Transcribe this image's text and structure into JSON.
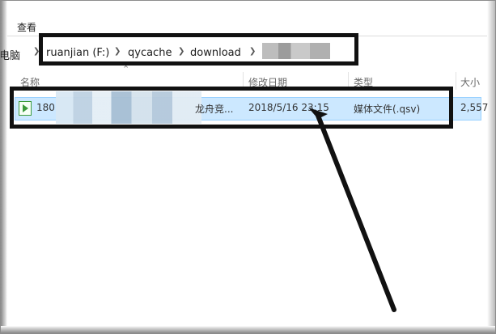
{
  "ribbon": {
    "view_label": "查看"
  },
  "address": {
    "root": "电脑",
    "crumbs": [
      "ruanjian (F:)",
      "qycache",
      "download"
    ],
    "last_crumb_blurred": true
  },
  "columns": {
    "name": "名称",
    "date": "修改日期",
    "type": "类型",
    "size": "大小"
  },
  "file": {
    "name_prefix": "180",
    "name_suffix": "龙舟竞...",
    "date": "2018/5/16 23:15",
    "type": "媒体文件(.qsv)",
    "size": "2,557"
  },
  "colors": {
    "selection": "#cce8ff",
    "selection_border": "#99d1ff",
    "annotation": "#111111"
  }
}
